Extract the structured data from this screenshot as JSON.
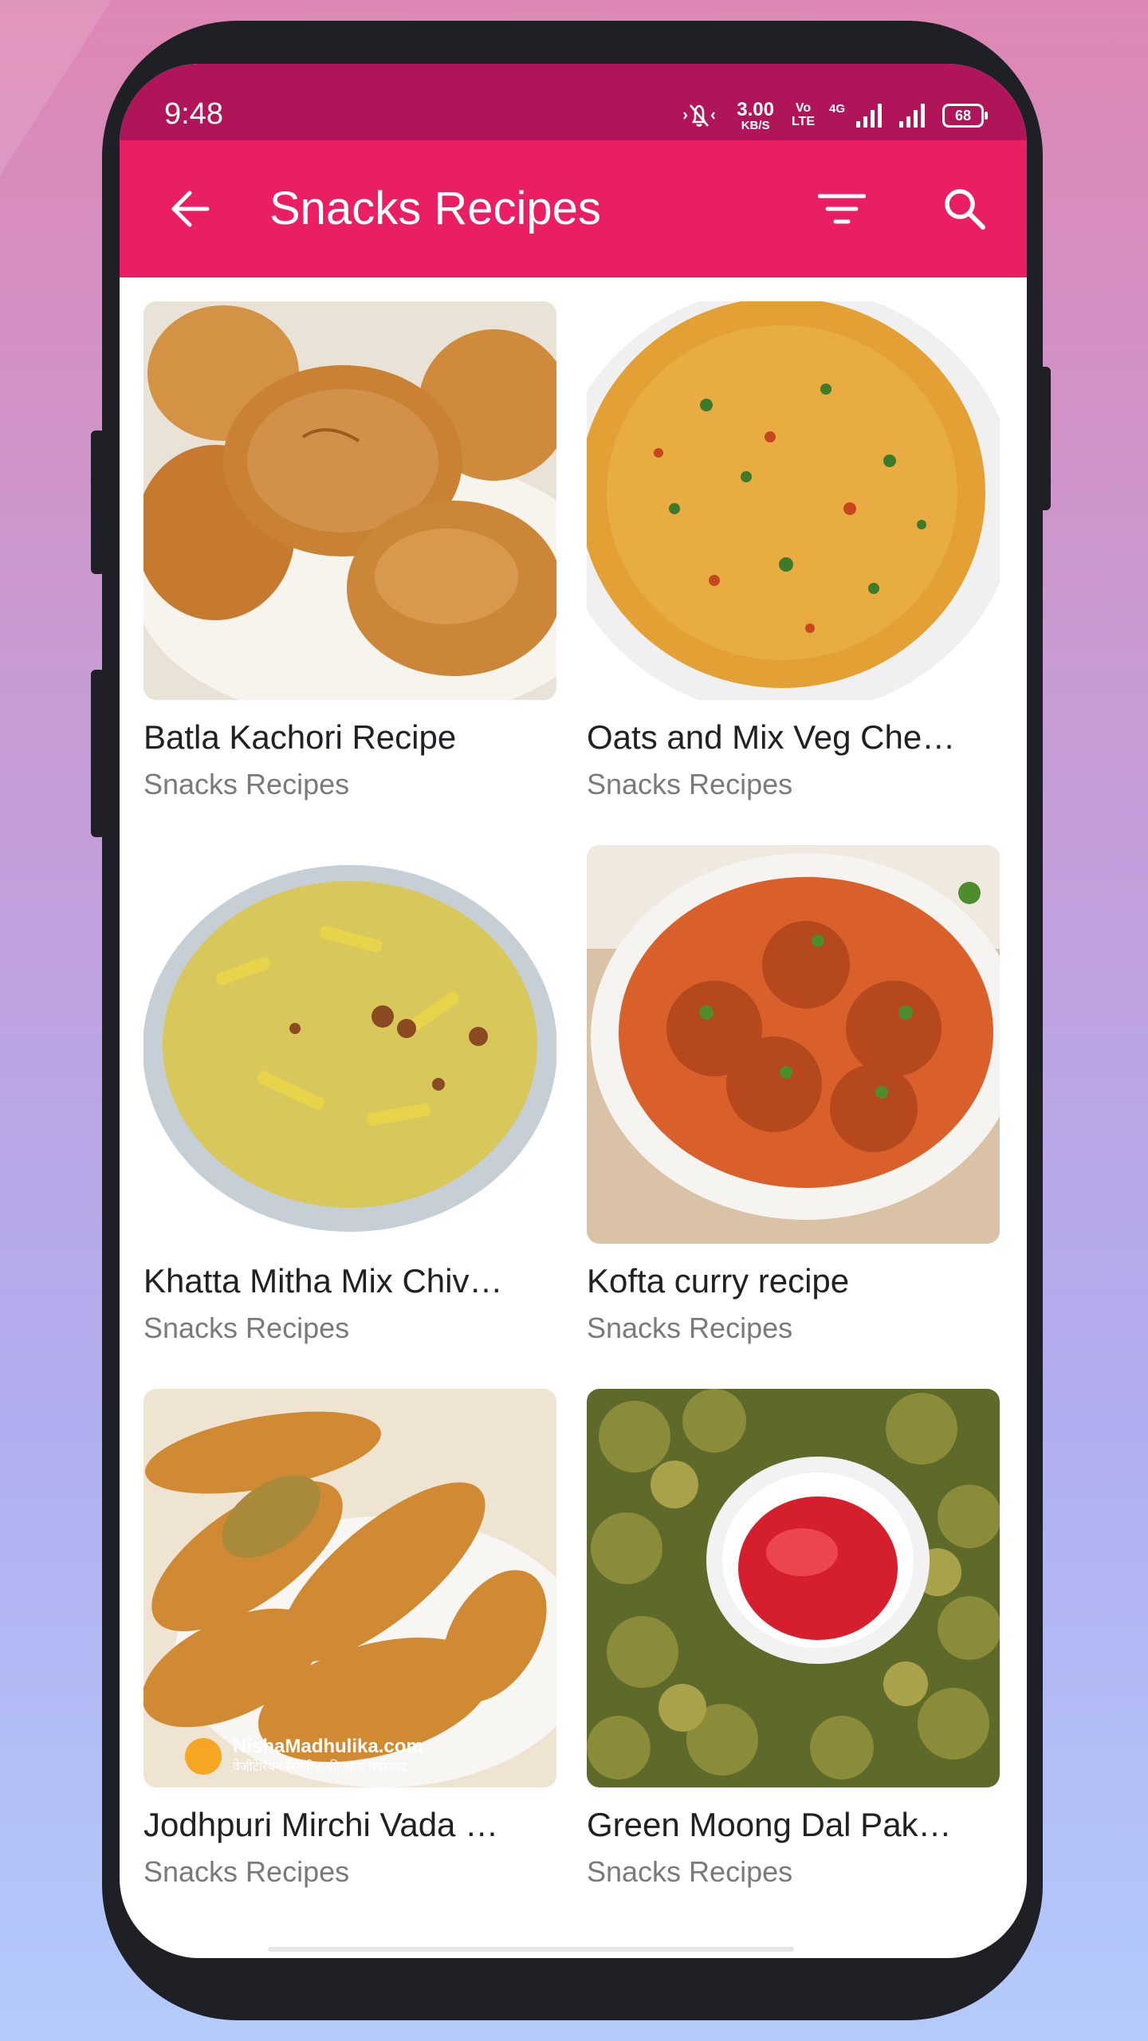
{
  "status_bar": {
    "time": "9:48",
    "speed_value": "3.00",
    "speed_unit": "KB/S",
    "volte_top": "Vo",
    "volte_bottom": "LTE",
    "network_type": "4G",
    "battery": "68",
    "icons": [
      "mute-icon",
      "network-4g-icon",
      "signal-icon",
      "battery-icon"
    ]
  },
  "app_bar": {
    "title": "Snacks Recipes",
    "background": "#e91e63",
    "status_color": "#b0155a",
    "icons": [
      "back-arrow-icon",
      "filter-icon",
      "search-icon"
    ]
  },
  "recipes": [
    {
      "title": "Batla Kachori Recipe",
      "category": "Snacks Recipes"
    },
    {
      "title": "Oats and Mix Veg Che…",
      "category": "Snacks Recipes"
    },
    {
      "title": "Khatta Mitha Mix Chiv…",
      "category": "Snacks Recipes"
    },
    {
      "title": "Kofta curry recipe",
      "category": "Snacks Recipes"
    },
    {
      "title": "Jodhpuri Mirchi Vada …",
      "category": "Snacks Recipes"
    },
    {
      "title": "Green Moong Dal Pak…",
      "category": "Snacks Recipes"
    }
  ],
  "watermark": {
    "brand": "NishaMadhulika.com",
    "tagline": "वेजीटेरियन रेसीपीज की खास वेबसाइट"
  }
}
